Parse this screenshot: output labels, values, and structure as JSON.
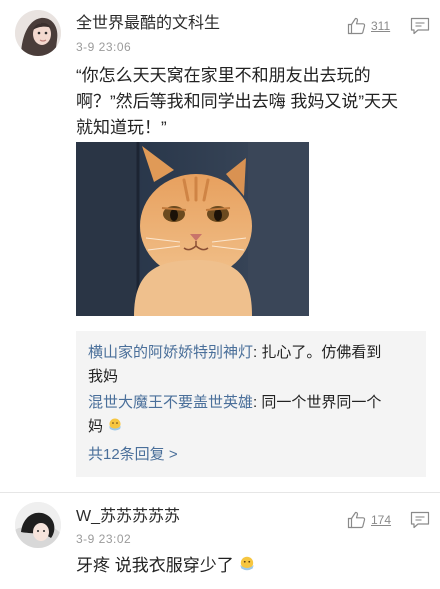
{
  "comments": [
    {
      "username": "全世界最酷的文科生",
      "timestamp": "3-9 23:06",
      "likes": "311",
      "text_line1": "“你怎么天天窝在家里不和朋友出去玩的",
      "text_line2": "啊？”然后等我和同学出去嗨 我妈又说”天天",
      "text_line3": "就知道玩！”",
      "replies": [
        {
          "user": "横山家的阿娇娇特别神灯",
          "text_a": ": 扎心了。仿佛看到",
          "text_b": "我妈"
        },
        {
          "user": "混世大魔王不要盖世英雄",
          "text_a": ": 同一个世界同一个",
          "text_b": "妈"
        }
      ],
      "more_replies": "共12条回复 >"
    },
    {
      "username": "W_苏苏苏苏苏",
      "timestamp": "3-9 23:02",
      "likes": "174",
      "text": "牙疼 说我衣服穿少了"
    }
  ],
  "icons": {
    "like": "thumbs-up-icon",
    "reply": "reply-bubble-icon",
    "emoji": "face-mask-emoji-icon"
  },
  "colors": {
    "link": "#4a6f9a",
    "meta": "#9b9b9b",
    "reply_bg": "#f4f4f4"
  }
}
